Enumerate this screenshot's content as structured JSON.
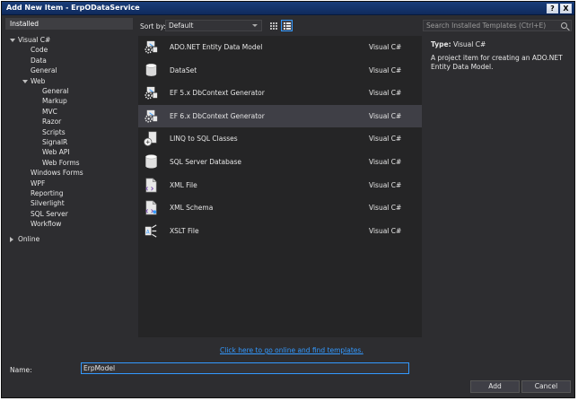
{
  "window": {
    "title": "Add New Item - ErpODataService",
    "help_glyph": "?",
    "close_glyph": "X"
  },
  "sidebar": {
    "header": "Installed",
    "tree": [
      {
        "label": "Visual C#",
        "indent": 0,
        "expander": "down"
      },
      {
        "label": "Code",
        "indent": 1
      },
      {
        "label": "Data",
        "indent": 1
      },
      {
        "label": "General",
        "indent": 1
      },
      {
        "label": "Web",
        "indent": 1,
        "expander": "down"
      },
      {
        "label": "General",
        "indent": 2
      },
      {
        "label": "Markup",
        "indent": 2
      },
      {
        "label": "MVC",
        "indent": 2
      },
      {
        "label": "Razor",
        "indent": 2
      },
      {
        "label": "Scripts",
        "indent": 2
      },
      {
        "label": "SignalR",
        "indent": 2
      },
      {
        "label": "Web API",
        "indent": 2
      },
      {
        "label": "Web Forms",
        "indent": 2
      },
      {
        "label": "Windows Forms",
        "indent": 1
      },
      {
        "label": "WPF",
        "indent": 1
      },
      {
        "label": "Reporting",
        "indent": 1
      },
      {
        "label": "Silverlight",
        "indent": 1
      },
      {
        "label": "SQL Server",
        "indent": 1
      },
      {
        "label": "Workflow",
        "indent": 1
      }
    ],
    "online": "Online"
  },
  "toolbar": {
    "sort_label": "Sort by:",
    "sort_value": "Default",
    "search_placeholder": "Search Installed Templates (Ctrl+E)"
  },
  "templates": [
    {
      "name": "ADO.NET Entity Data Model",
      "lang": "Visual C#",
      "icon": "entity-model-icon"
    },
    {
      "name": "DataSet",
      "lang": "Visual C#",
      "icon": "dataset-icon"
    },
    {
      "name": "EF 5.x DbContext Generator",
      "lang": "Visual C#",
      "icon": "dbcontext-generator-icon"
    },
    {
      "name": "EF 6.x DbContext Generator",
      "lang": "Visual C#",
      "icon": "dbcontext-generator-icon",
      "selected": true
    },
    {
      "name": "LINQ to SQL Classes",
      "lang": "Visual C#",
      "icon": "linq-to-sql-icon"
    },
    {
      "name": "SQL Server Database",
      "lang": "Visual C#",
      "icon": "database-icon"
    },
    {
      "name": "XML File",
      "lang": "Visual C#",
      "icon": "xml-file-icon"
    },
    {
      "name": "XML Schema",
      "lang": "Visual C#",
      "icon": "xml-schema-icon"
    },
    {
      "name": "XSLT File",
      "lang": "Visual C#",
      "icon": "xslt-file-icon"
    }
  ],
  "details": {
    "type_label": "Type:",
    "type_value": "Visual C#",
    "description": "A project item for creating an ADO.NET Entity Data Model."
  },
  "online_link": "Click here to go online and find templates.",
  "name_field": {
    "label": "Name:",
    "value": "ErpModel"
  },
  "buttons": {
    "add": "Add",
    "cancel": "Cancel"
  },
  "colors": {
    "background": "#2d2d30",
    "list_bg": "#252526",
    "selection": "#3f3f46",
    "accent": "#3399ff"
  }
}
